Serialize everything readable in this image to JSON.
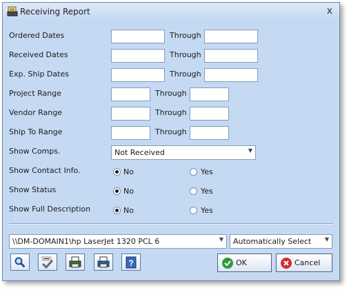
{
  "window": {
    "title": "Receiving Report",
    "close_label": "x"
  },
  "rows": [
    {
      "label": "Ordered Dates",
      "through": "Through"
    },
    {
      "label": "Received Dates",
      "through": "Through"
    },
    {
      "label": "Exp. Ship Dates",
      "through": "Through"
    },
    {
      "label": "Project Range",
      "through": "Through"
    },
    {
      "label": "Vendor Range",
      "through": "Through"
    },
    {
      "label": "Ship To Range",
      "through": "Through"
    }
  ],
  "show_comps": {
    "label": "Show Comps.",
    "value": "Not Received"
  },
  "options": [
    {
      "label": "Show Contact Info.",
      "no": "No",
      "yes": "Yes",
      "selected": "No"
    },
    {
      "label": "Show Status",
      "no": "No",
      "yes": "Yes",
      "selected": "No"
    },
    {
      "label": "Show Full Description",
      "no": "No",
      "yes": "Yes",
      "selected": "No"
    }
  ],
  "printer": {
    "value": "\\\\DM-DOMAIN1\\hp LaserJet 1320 PCL 6"
  },
  "tray": {
    "value": "Automatically Select"
  },
  "toolbar_icons": [
    "magnify-icon",
    "spell-check-icon",
    "print-preview-icon",
    "printer-setup-icon",
    "help-icon"
  ],
  "buttons": {
    "ok": "OK",
    "cancel": "Cancel"
  }
}
